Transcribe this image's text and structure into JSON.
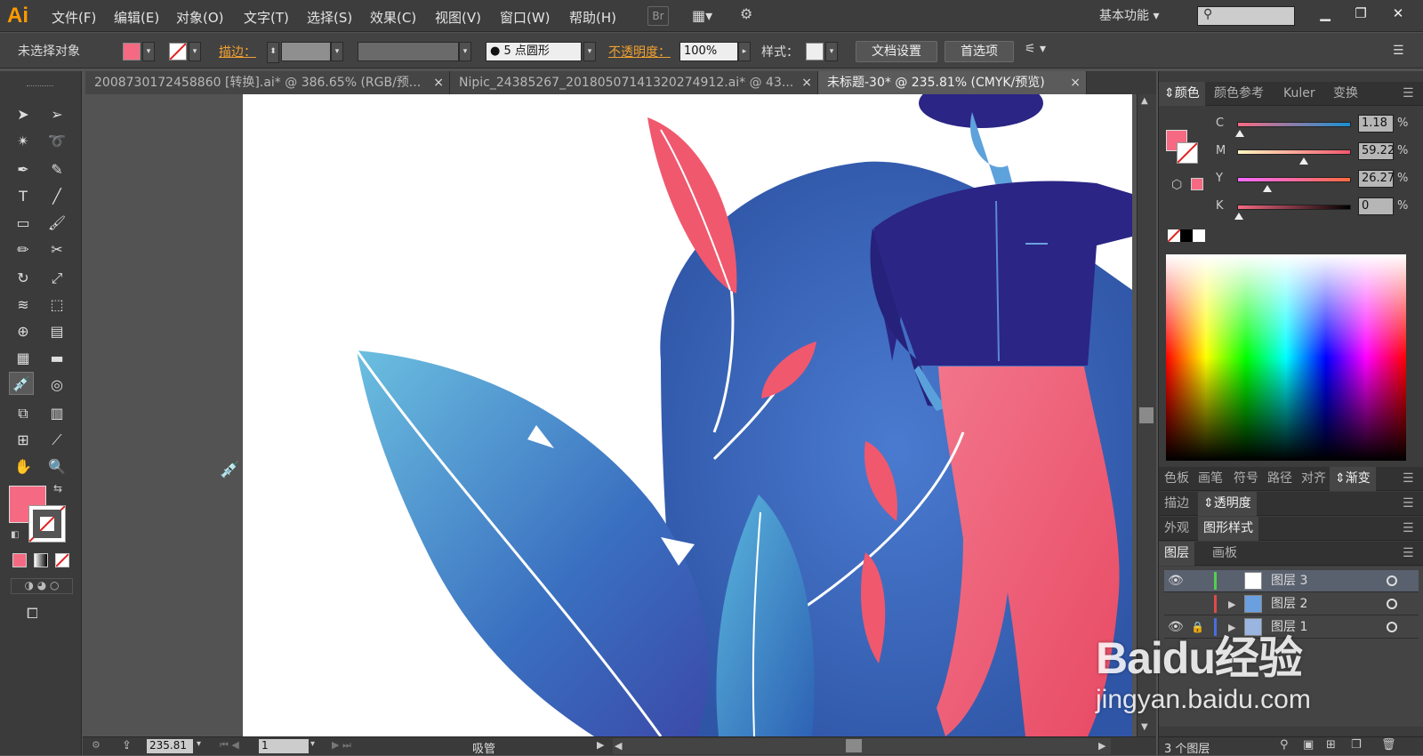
{
  "app": {
    "logo": "Ai"
  },
  "menu": [
    "文件(F)",
    "编辑(E)",
    "对象(O)",
    "文字(T)",
    "选择(S)",
    "效果(C)",
    "视图(V)",
    "窗口(W)",
    "帮助(H)"
  ],
  "menubar": {
    "br_label": "Br",
    "workspace": "基本功能",
    "window_buttons": [
      "▁",
      "❐",
      "✕"
    ]
  },
  "control_bar": {
    "selection": "未选择对象",
    "stroke_label": "描边：",
    "brush": "5 点圆形",
    "opacity_label": "不透明度：",
    "opacity_value": "100%",
    "style_label": "样式：",
    "doc_setup": "文档设置",
    "preferences": "首选项"
  },
  "tabs": [
    {
      "title": "200873017245886​0 [转换].ai* @ 386.65% (RGB/预...",
      "active": false
    },
    {
      "title": "Nipic_24385267_20180507141320274912.ai* @ 43...",
      "active": false
    },
    {
      "title": "未标题-30* @ 235.81% (CMYK/预览)",
      "active": true
    }
  ],
  "tools": [
    "selection-arrow",
    "direct-selection",
    "magic-wand",
    "lasso",
    "pen",
    "curvature-pen",
    "type",
    "line-segment",
    "rectangle",
    "paintbrush",
    "pencil",
    "scissors",
    "rotate",
    "scale",
    "warp",
    "free-transform",
    "shape-builder",
    "graph",
    "mesh",
    "gradient",
    "eyedropper",
    "blend",
    "symbol-sprayer",
    "column-graph",
    "artboard",
    "slice",
    "hand",
    "zoom"
  ],
  "status_bar": {
    "zoom": "235.81",
    "page": "1",
    "tool_name": "吸管"
  },
  "colors": {
    "fill": "#f56a82",
    "accent_orange": "#f0a030",
    "art_blue": "#3a63b8",
    "art_pink": "#f0586e",
    "shirt": "#2b2585"
  },
  "color_panel": {
    "tabs": [
      "颜色",
      "颜色参考",
      "Kuler",
      "变换"
    ],
    "channels": [
      {
        "label": "C",
        "value": "1.18",
        "pos": 0.01
      },
      {
        "label": "M",
        "value": "59.22",
        "pos": 0.59
      },
      {
        "label": "Y",
        "value": "26.27",
        "pos": 0.26
      },
      {
        "label": "K",
        "value": "0",
        "pos": 0.0
      }
    ],
    "percent": "%"
  },
  "panel_rows": {
    "row1": [
      "色板",
      "画笔",
      "符号",
      "路径",
      "对齐",
      "渐变"
    ],
    "row2": [
      "描边",
      "透明度"
    ],
    "row3": [
      "外观",
      "图形样式"
    ],
    "row4": [
      "图层",
      "画板"
    ]
  },
  "layers": [
    {
      "name": "图层 3",
      "selected": true
    },
    {
      "name": "图层 2",
      "selected": false
    },
    {
      "name": "图层 1",
      "selected": false
    }
  ],
  "layers_footer": "3 个图层",
  "watermark": {
    "brand": "Baidu经验",
    "url": "jingyan.baidu.com"
  }
}
